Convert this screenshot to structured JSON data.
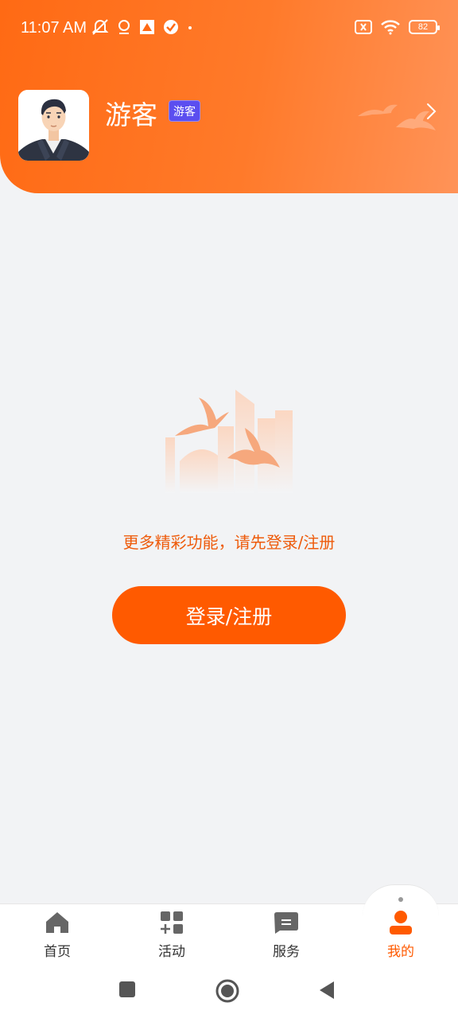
{
  "status_bar": {
    "time": "11:07 AM",
    "battery": "82"
  },
  "profile": {
    "name": "游客",
    "badge": "游客"
  },
  "empty_state": {
    "message": "更多精彩功能，请先登录/注册",
    "button_label": "登录/注册"
  },
  "tabs": [
    {
      "label": "首页",
      "icon": "home-icon"
    },
    {
      "label": "活动",
      "icon": "grid-plus-icon"
    },
    {
      "label": "服务",
      "icon": "message-icon"
    },
    {
      "label": "我的",
      "icon": "user-icon",
      "active": true
    }
  ],
  "colors": {
    "brand": "#ff5a00",
    "header_start": "#ff6a14",
    "header_end": "#ff9358",
    "badge": "#5b4ef0"
  }
}
